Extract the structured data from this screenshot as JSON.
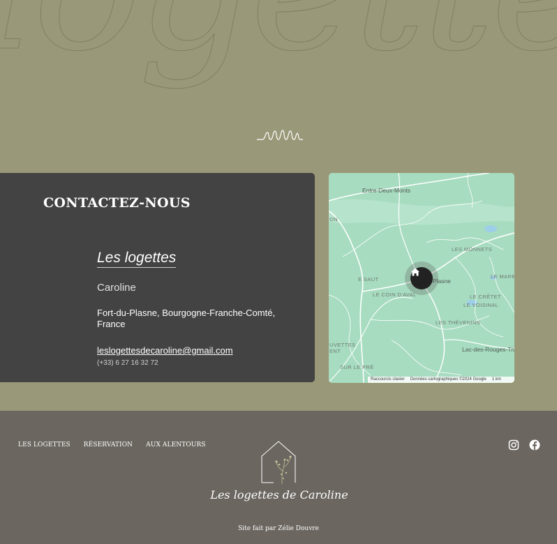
{
  "hero": {
    "background_word": "logettes"
  },
  "contact": {
    "title": "CONTACTEZ-NOUS",
    "business_name": "Les logettes",
    "owner": "Caroline",
    "address": "Fort-du-Plasne, Bourgogne-Franche-Comté, France",
    "email": "leslogettesdecaroline@gmail.com",
    "phone": "(+33) 6 27 16 32 72"
  },
  "map": {
    "labels": {
      "entre_deux_monts": "Entre-Deux-Monts",
      "on": "ON",
      "les_monnets": "LES MONNETS",
      "le_mare": "LE MARE",
      "e_saut": "E SAUT",
      "fort_du_plasne": "-Plasne",
      "le_coin_d_aval": "LE COIN D'AVAL",
      "le_cretet": "LE CRÊTET",
      "le_voisinal": "LE VOISINAL",
      "les_thevenins": "LES THÉVENINS",
      "uvettes": "UVETTES",
      "ent": "ENT",
      "lac_des_rouges_truites": "Lac-des-Rouges-Tru",
      "sur_le_pre": "SUR LE PRÉ"
    },
    "footer": {
      "shortcuts": "Raccourcis clavier",
      "copyright": "Données cartographiques ©2024 Google",
      "scale": "1 km"
    },
    "colors": {
      "land": "#a7dcc0",
      "roads": "#ffffff",
      "water": "#9dcfe8"
    },
    "pin_icon": "home-icon"
  },
  "footer": {
    "nav": [
      "LES LOGETTES",
      "RÉSERVATION",
      "AUX ALENTOURS"
    ],
    "logo_text": "Les logettes de Caroline",
    "credit": "Site fait par Zélie Douvre",
    "social": [
      "instagram-icon",
      "facebook-icon"
    ]
  },
  "colors": {
    "hero_bg": "#999878",
    "card_bg": "#434343",
    "footer_bg": "#6b6660",
    "text": "#ffffff"
  }
}
